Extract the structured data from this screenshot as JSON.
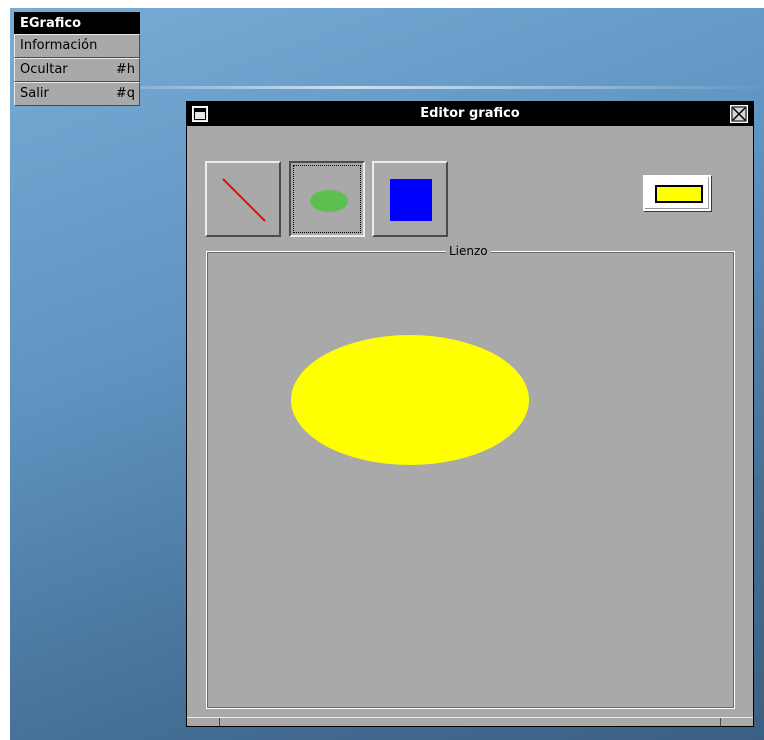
{
  "app_menu": {
    "title": "EGrafico",
    "items": [
      {
        "label": "Información",
        "shortcut": ""
      },
      {
        "label": "Ocultar",
        "shortcut": "#h"
      },
      {
        "label": "Salir",
        "shortcut": "#q"
      }
    ]
  },
  "window": {
    "title": "Editor grafico",
    "menu_icon": "window-menu-icon",
    "close_icon": "close-icon"
  },
  "toolbar": {
    "tools": [
      {
        "name": "line",
        "icon": "line-icon",
        "color": "#ff0000",
        "selected": false
      },
      {
        "name": "ellipse",
        "icon": "ellipse-icon",
        "color": "#5cc04e",
        "selected": true
      },
      {
        "name": "rectangle",
        "icon": "rectangle-icon",
        "color": "#0000ff",
        "selected": false
      }
    ],
    "current_color": "#ffff00"
  },
  "canvas": {
    "label": "Lienzo",
    "background": "#a9a9a9",
    "shapes": [
      {
        "type": "ellipse",
        "fill": "#ffff00"
      }
    ]
  }
}
